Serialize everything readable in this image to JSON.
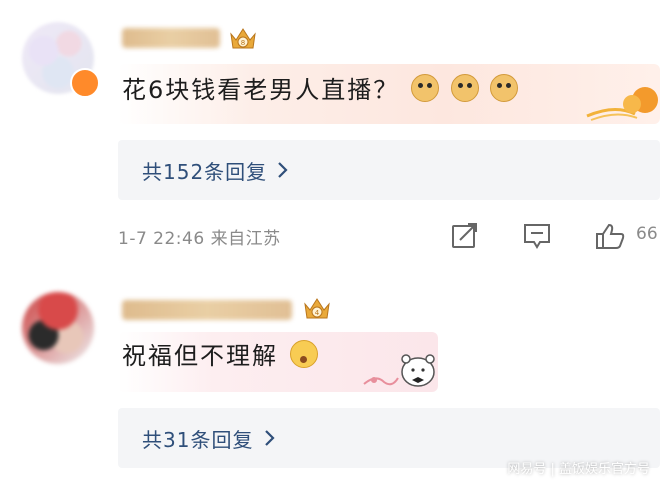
{
  "comments": [
    {
      "text": "花6块钱看老男人直播？",
      "emojis": [
        "doge",
        "doge",
        "doge"
      ],
      "replies_label": "共152条回复",
      "time_location": "1-7 22:46 来自江苏",
      "like_count": "66"
    },
    {
      "text": "祝福但不理解",
      "emojis": [
        "thinking"
      ],
      "replies_label": "共31条回复"
    }
  ],
  "watermark": "网易号 | 盖饭娱乐官方号",
  "colors": {
    "link": "#2f4f7a",
    "meta": "#8a8a8a",
    "reply_box": "#f4f5f7",
    "badge": "#ff8a2a"
  },
  "icons": [
    "vip-crown-icon",
    "chevron-right-icon",
    "share-icon",
    "comment-icon",
    "like-icon",
    "doge-emoji",
    "thinking-emoji"
  ]
}
